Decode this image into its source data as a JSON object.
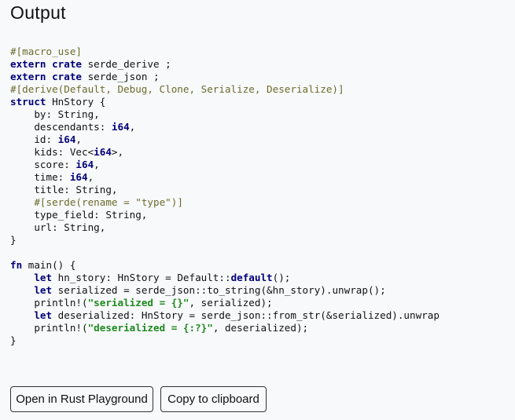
{
  "page": {
    "title": "Output"
  },
  "code": {
    "lines": [
      [
        {
          "t": "attr",
          "v": "#[macro_use]"
        }
      ],
      [
        {
          "t": "kw",
          "v": "extern"
        },
        {
          "t": "plain",
          "v": " "
        },
        {
          "t": "kw",
          "v": "crate"
        },
        {
          "t": "plain",
          "v": " serde_derive ;"
        }
      ],
      [
        {
          "t": "kw",
          "v": "extern"
        },
        {
          "t": "plain",
          "v": " "
        },
        {
          "t": "kw",
          "v": "crate"
        },
        {
          "t": "plain",
          "v": " serde_json ;"
        }
      ],
      [
        {
          "t": "attr",
          "v": "#[derive(Default, Debug, Clone, Serialize, Deserialize)]"
        }
      ],
      [
        {
          "t": "kw",
          "v": "struct"
        },
        {
          "t": "plain",
          "v": " HnStory {"
        }
      ],
      [
        {
          "t": "plain",
          "v": "    by: String,"
        }
      ],
      [
        {
          "t": "plain",
          "v": "    descendants: "
        },
        {
          "t": "kw",
          "v": "i64"
        },
        {
          "t": "plain",
          "v": ","
        }
      ],
      [
        {
          "t": "plain",
          "v": "    id: "
        },
        {
          "t": "kw",
          "v": "i64"
        },
        {
          "t": "plain",
          "v": ","
        }
      ],
      [
        {
          "t": "plain",
          "v": "    kids: Vec<"
        },
        {
          "t": "kw",
          "v": "i64"
        },
        {
          "t": "plain",
          "v": ">,"
        }
      ],
      [
        {
          "t": "plain",
          "v": "    score: "
        },
        {
          "t": "kw",
          "v": "i64"
        },
        {
          "t": "plain",
          "v": ","
        }
      ],
      [
        {
          "t": "plain",
          "v": "    time: "
        },
        {
          "t": "kw",
          "v": "i64"
        },
        {
          "t": "plain",
          "v": ","
        }
      ],
      [
        {
          "t": "plain",
          "v": "    title: String,"
        }
      ],
      [
        {
          "t": "plain",
          "v": "    "
        },
        {
          "t": "attr",
          "v": "#[serde(rename = \"type\")]"
        }
      ],
      [
        {
          "t": "plain",
          "v": "    type_field: String,"
        }
      ],
      [
        {
          "t": "plain",
          "v": "    url: String,"
        }
      ],
      [
        {
          "t": "plain",
          "v": "}"
        }
      ],
      [
        {
          "t": "plain",
          "v": ""
        }
      ],
      [
        {
          "t": "kw",
          "v": "fn"
        },
        {
          "t": "plain",
          "v": " main() {"
        }
      ],
      [
        {
          "t": "plain",
          "v": "    "
        },
        {
          "t": "kw",
          "v": "let"
        },
        {
          "t": "plain",
          "v": " hn_story: HnStory = Default::"
        },
        {
          "t": "kw",
          "v": "default"
        },
        {
          "t": "plain",
          "v": "();"
        }
      ],
      [
        {
          "t": "plain",
          "v": "    "
        },
        {
          "t": "kw",
          "v": "let"
        },
        {
          "t": "plain",
          "v": " serialized = serde_json::to_string(&hn_story).unwrap();"
        }
      ],
      [
        {
          "t": "plain",
          "v": "    println!("
        },
        {
          "t": "str",
          "v": "\"serialized = {}\""
        },
        {
          "t": "plain",
          "v": ", serialized);"
        }
      ],
      [
        {
          "t": "plain",
          "v": "    "
        },
        {
          "t": "kw",
          "v": "let"
        },
        {
          "t": "plain",
          "v": " deserialized: HnStory = serde_json::from_str(&serialized).unwrap"
        }
      ],
      [
        {
          "t": "plain",
          "v": "    println!("
        },
        {
          "t": "str",
          "v": "\"deserialized = {:?}\""
        },
        {
          "t": "plain",
          "v": ", deserialized);"
        }
      ],
      [
        {
          "t": "plain",
          "v": "}"
        }
      ]
    ]
  },
  "actions": {
    "playground_label": "Open in Rust Playground",
    "copy_label": "Copy to clipboard"
  },
  "colors": {
    "background": "#f8f9fb",
    "keyword": "#00007a",
    "attribute": "#6b6b2a",
    "string": "#1e8a1e"
  }
}
